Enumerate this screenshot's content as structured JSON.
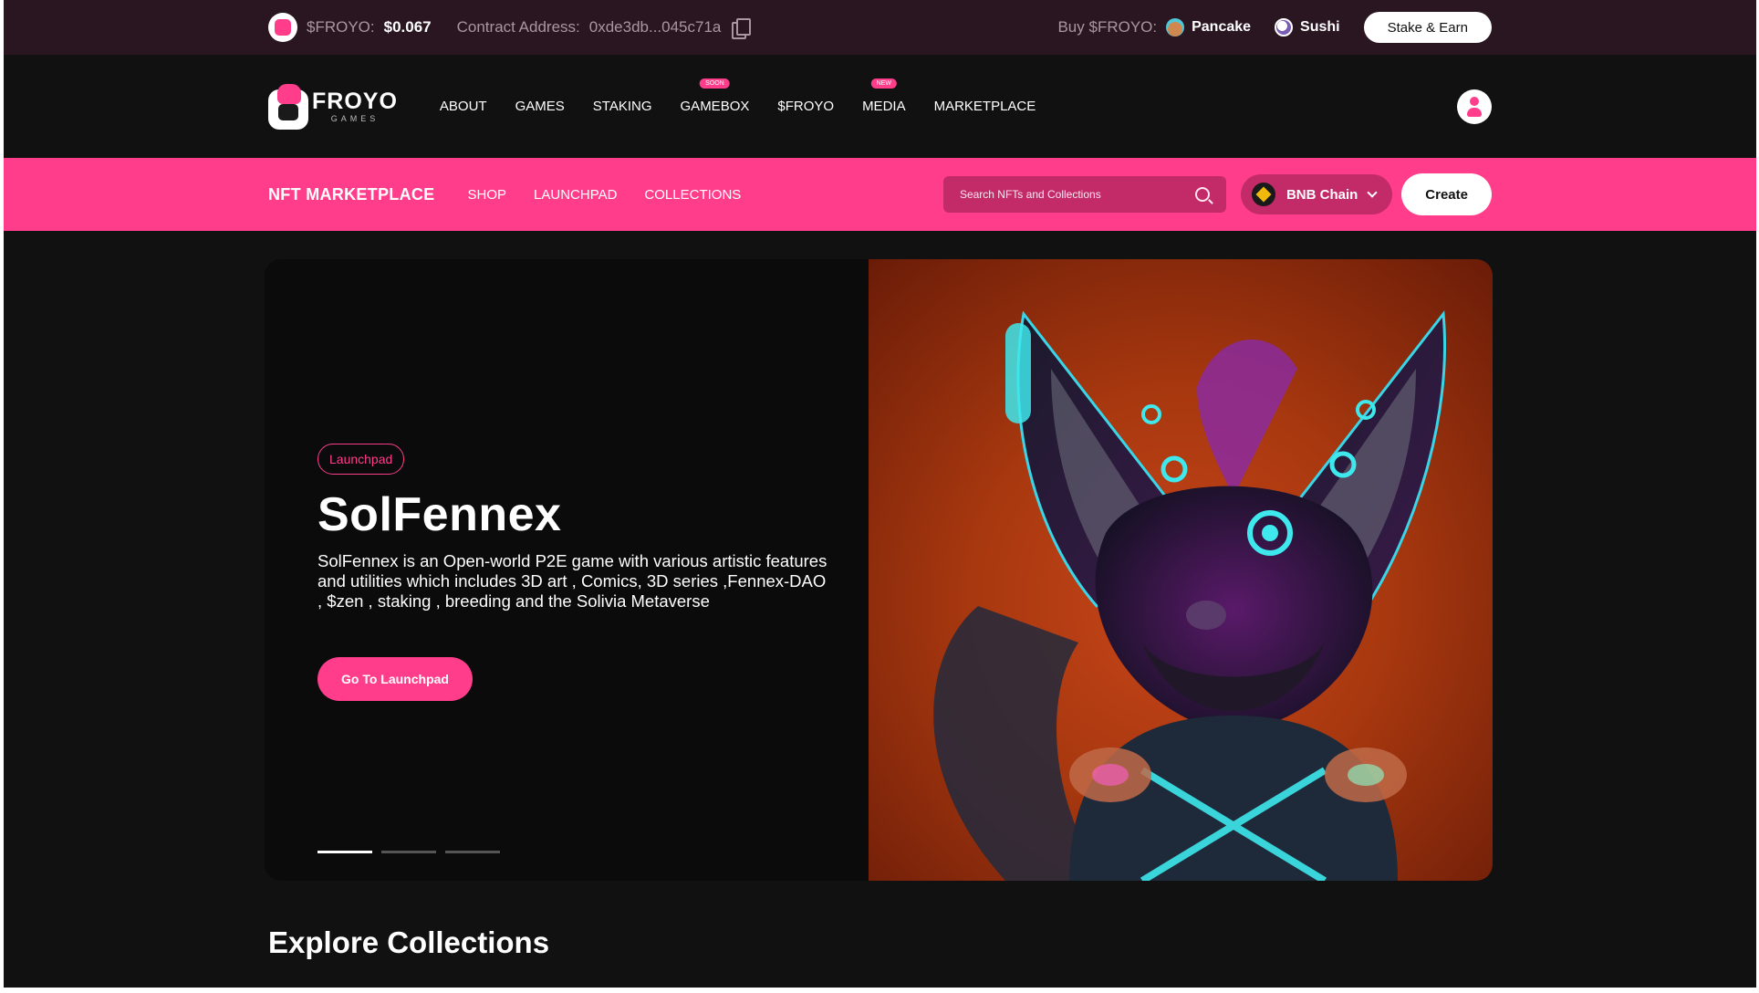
{
  "topbar": {
    "token_label": "$FROYO:",
    "token_price": "$0.067",
    "contract_label": "Contract Address:",
    "contract_value": "0xde3db...045c71a",
    "buy_label": "Buy $FROYO:",
    "dex_pancake": "Pancake",
    "dex_sushi": "Sushi",
    "stake_button": "Stake & Earn"
  },
  "brand": {
    "name": "FROYO",
    "sub": "GAMES"
  },
  "nav": {
    "items": [
      {
        "label": "ABOUT",
        "badge": ""
      },
      {
        "label": "GAMES",
        "badge": ""
      },
      {
        "label": "STAKING",
        "badge": ""
      },
      {
        "label": "GAMEBOX",
        "badge": "SOON"
      },
      {
        "label": "$FROYO",
        "badge": ""
      },
      {
        "label": "MEDIA",
        "badge": "NEW"
      },
      {
        "label": "MARKETPLACE",
        "badge": ""
      }
    ]
  },
  "subnav": {
    "title": "NFT MARKETPLACE",
    "items": [
      "SHOP",
      "LAUNCHPAD",
      "COLLECTIONS"
    ],
    "search_placeholder": "Search NFTs and Collections",
    "chain": "BNB Chain",
    "create_button": "Create"
  },
  "hero": {
    "tag": "Launchpad",
    "title": "SolFennex",
    "description": "SolFennex is an Open-world P2E game with various artistic features and utilities which includes 3D art , Comics, 3D series ,Fennex-DAO , $zen , staking , breeding and the Solivia Metaverse",
    "button": "Go To Launchpad",
    "slides_total": 3,
    "slide_active": 1
  },
  "section": {
    "title": "Explore Collections"
  },
  "colors": {
    "accent": "#ff3d8b",
    "topbar_bg": "#2a1620",
    "page_bg": "#111111"
  }
}
